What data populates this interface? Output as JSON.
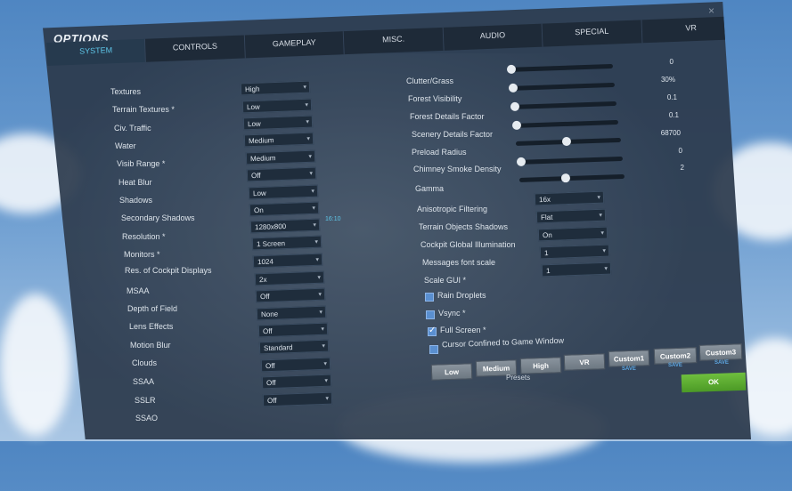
{
  "window": {
    "title": "OPTIONS",
    "close_label": "×"
  },
  "tabs": [
    {
      "label": "SYSTEM",
      "active": true
    },
    {
      "label": "CONTROLS",
      "active": false
    },
    {
      "label": "GAMEPLAY",
      "active": false
    },
    {
      "label": "MISC.",
      "active": false
    },
    {
      "label": "AUDIO",
      "active": false
    },
    {
      "label": "SPECIAL",
      "active": false
    },
    {
      "label": "VR",
      "active": false
    }
  ],
  "left": {
    "textures": {
      "label": "Textures",
      "value": "High"
    },
    "terrain_textures": {
      "label": "Terrain Textures *",
      "value": "Low"
    },
    "civ_traffic": {
      "label": "Civ. Traffic",
      "value": "Low"
    },
    "water": {
      "label": "Water",
      "value": "Medium"
    },
    "visib_range": {
      "label": "Visib Range *",
      "value": "Medium"
    },
    "heat_blur": {
      "label": "Heat Blur",
      "value": "Off"
    },
    "shadows": {
      "label": "Shadows",
      "value": "Low"
    },
    "secondary_shadows": {
      "label": "Secondary Shadows",
      "value": "On"
    },
    "resolution": {
      "label": "Resolution *",
      "value": "1280x800",
      "aspect": "16:10"
    },
    "monitors": {
      "label": "Monitors *",
      "value": "1 Screen"
    },
    "res_cockpit": {
      "label": "Res. of Cockpit Displays",
      "value": "1024"
    },
    "msaa": {
      "label": "MSAA",
      "value": "2x"
    },
    "depth_of_field": {
      "label": "Depth of Field",
      "value": "Off"
    },
    "lens_effects": {
      "label": "Lens Effects",
      "value": "None"
    },
    "motion_blur": {
      "label": "Motion Blur",
      "value": "Off"
    },
    "clouds": {
      "label": "Clouds",
      "value": "Standard"
    },
    "ssaa": {
      "label": "SSAA",
      "value": "Off"
    },
    "sslr": {
      "label": "SSLR",
      "value": "Off"
    },
    "ssao": {
      "label": "SSAO",
      "value": "Off"
    }
  },
  "right_sliders": {
    "clutter": {
      "label": "Clutter/Grass",
      "value": "0"
    },
    "forest_visibility": {
      "label": "Forest Visibility",
      "value": "30%"
    },
    "forest_details": {
      "label": "Forest Details Factor",
      "value": "0.1"
    },
    "scenery_details": {
      "label": "Scenery Details Factor",
      "value": "0.1"
    },
    "preload_radius": {
      "label": "Preload Radius",
      "value": "68700"
    },
    "chimney_smoke": {
      "label": "Chimney Smoke Density",
      "value": "0"
    },
    "gamma": {
      "label": "Gamma",
      "value": "2"
    }
  },
  "right_selects": {
    "anisotropic": {
      "label": "Anisotropic Filtering",
      "value": "16x"
    },
    "terrain_object_shadows": {
      "label": "Terrain Objects Shadows",
      "value": "Flat"
    },
    "cockpit_illumination": {
      "label": "Cockpit Global Illumination",
      "value": "On"
    },
    "messages_font_scale": {
      "label": "Messages font scale",
      "value": "1"
    },
    "scale_gui": {
      "label": "Scale GUI *",
      "value": "1"
    }
  },
  "checkboxes": {
    "rain_droplets": {
      "label": "Rain Droplets",
      "checked": false
    },
    "vsync": {
      "label": "Vsync *",
      "checked": false
    },
    "full_screen": {
      "label": "Full Screen *",
      "checked": true
    },
    "cursor_confined": {
      "label": "Cursor Confined to Game Window",
      "checked": false
    }
  },
  "presets": {
    "label": "Presets",
    "buttons": [
      "Low",
      "Medium",
      "High",
      "VR",
      "Custom1",
      "Custom2",
      "Custom3"
    ],
    "save_label": "SAVE"
  },
  "ok_label": "OK"
}
